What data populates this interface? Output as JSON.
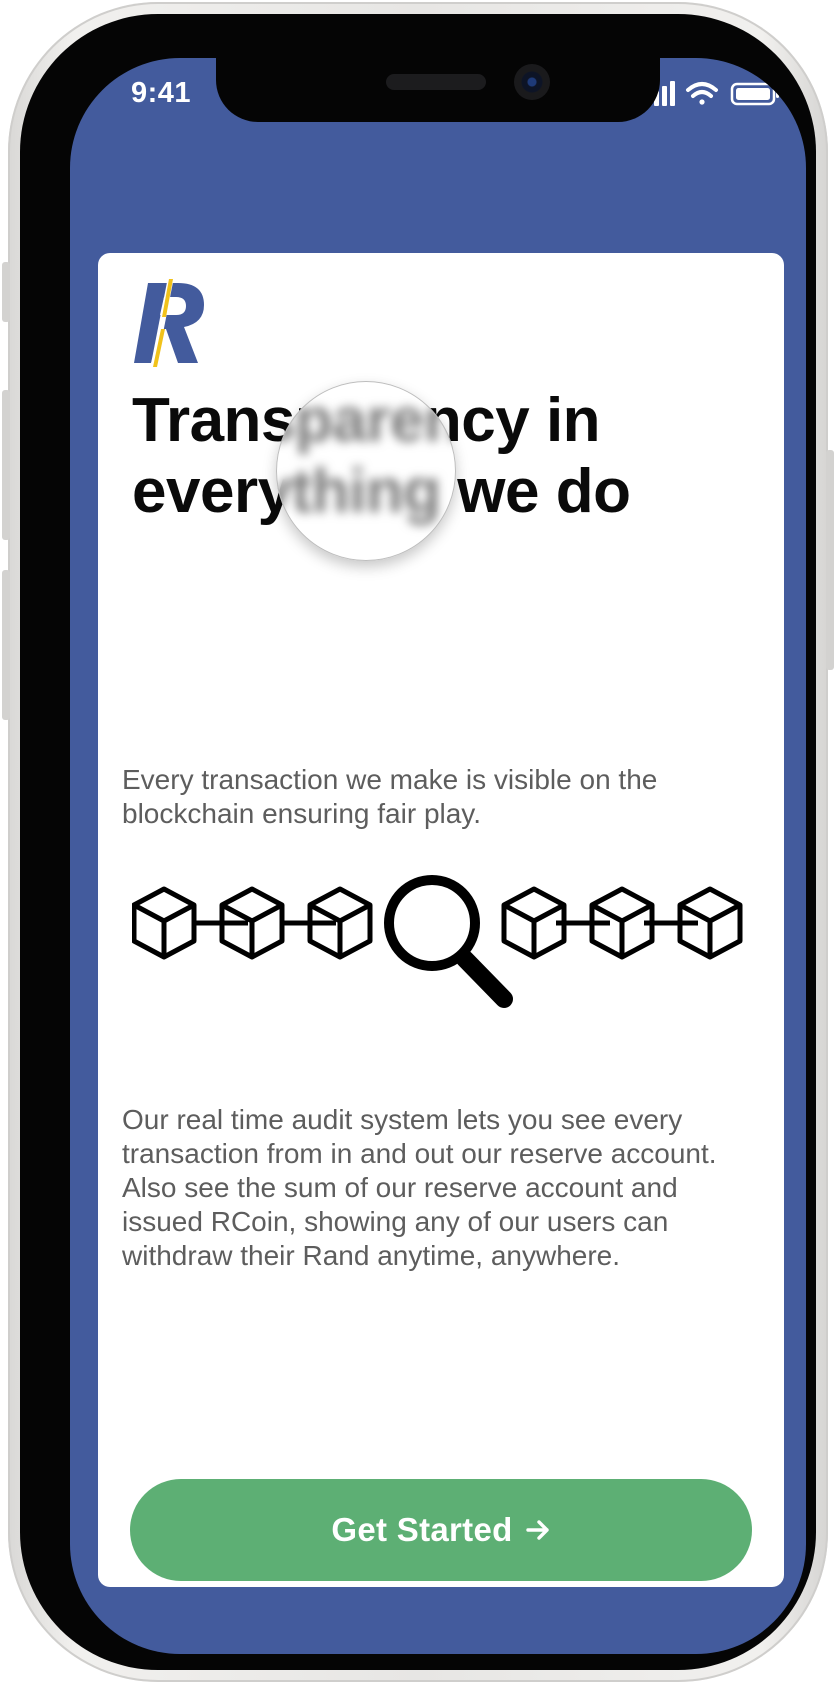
{
  "status_bar": {
    "time": "9:41",
    "icons": [
      "signal-icon",
      "wifi-icon",
      "battery-icon"
    ]
  },
  "brand": {
    "logo_text": "R",
    "primary_color": "#435b9d",
    "accent_color": "#f1c21b"
  },
  "onboarding": {
    "headline": "Transparency in everything we do",
    "intro": "Every transaction we make is visible on the blockchain ensuring fair play.",
    "illustration": "blockchain-audit-illustration",
    "body": "Our real time audit system lets you see every transaction from in and out our reserve account. Also see the sum of our reserve account and issued RCoin, showing any of our users can withdraw their Rand anytime, anywhere.",
    "cta_label": "Get Started",
    "cta_color": "#5daf74"
  }
}
